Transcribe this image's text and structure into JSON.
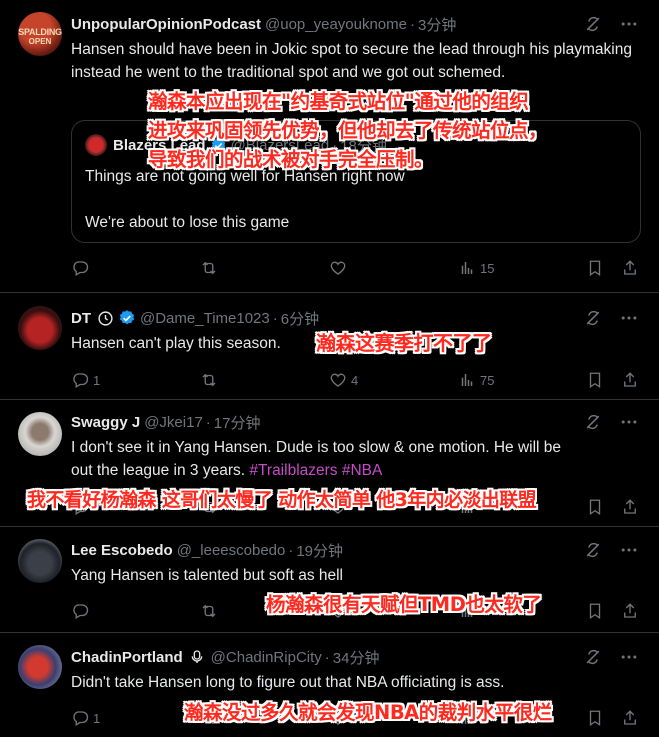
{
  "colors": {
    "background": "#000000",
    "text": "#e7e9ea",
    "muted": "#71767b",
    "hashtag": "#c64cc7",
    "verified": "#1d9bf0",
    "overlay_text": "#ff2a1f"
  },
  "tweets": [
    {
      "name": "UnpopularOpinionPodcast",
      "handle": "@uop_yeayouknome",
      "time": "3分钟",
      "avatar_text": "SPALDING",
      "avatar_sub": "OPEN",
      "text": "Hansen should have been in Jokic spot to  secure the lead through his playmaking instead he went to the traditional spot and we got out schemed.",
      "quote": {
        "name": "Blazers Lead",
        "handle": "@BlazersLead",
        "time": "18分钟",
        "line1": "Things are not going well for Hansen right now",
        "line2": "We're about to lose this game"
      },
      "views": "15",
      "overlay": [
        "瀚森本应出现在\"约基奇式站位\"通过他的组织",
        "进攻来巩固领先优势，但他却去了传统站位点，",
        "导致我们的战术被对手完全压制。"
      ]
    },
    {
      "name": "DT",
      "handle": "@Dame_Time1023",
      "time": "6分钟",
      "text": "Hansen can't play this season.",
      "replies": "1",
      "likes": "4",
      "views": "75",
      "overlay": "瀚森这赛季打不了了"
    },
    {
      "name": "Swaggy J",
      "handle": "@Jkei17",
      "time": "17分钟",
      "text_line1": "I don't see it in Yang Hansen. Dude is too slow & one motion. He will be",
      "text_line2": "out the league in 3 years.",
      "hashtag1": "#Trailblazers",
      "hashtag2": "#NBA",
      "overlay": "我不看好杨瀚森 这哥们太慢了 动作太简单 他3年内必淡出联盟"
    },
    {
      "name": "Lee Escobedo",
      "handle": "@_leeescobedo",
      "time": "19分钟",
      "text": "Yang Hansen is talented but soft as hell",
      "overlay": "杨瀚森很有天赋但TMD也太软了"
    },
    {
      "name": "ChadinPortland",
      "handle": "@ChadinRipCity",
      "time": "34分钟",
      "text": "Didn't take Hansen long to figure out that NBA officiating is ass.",
      "replies": "1",
      "overlay": "瀚森没过多久就会发现NBA的裁判水平很烂"
    }
  ]
}
